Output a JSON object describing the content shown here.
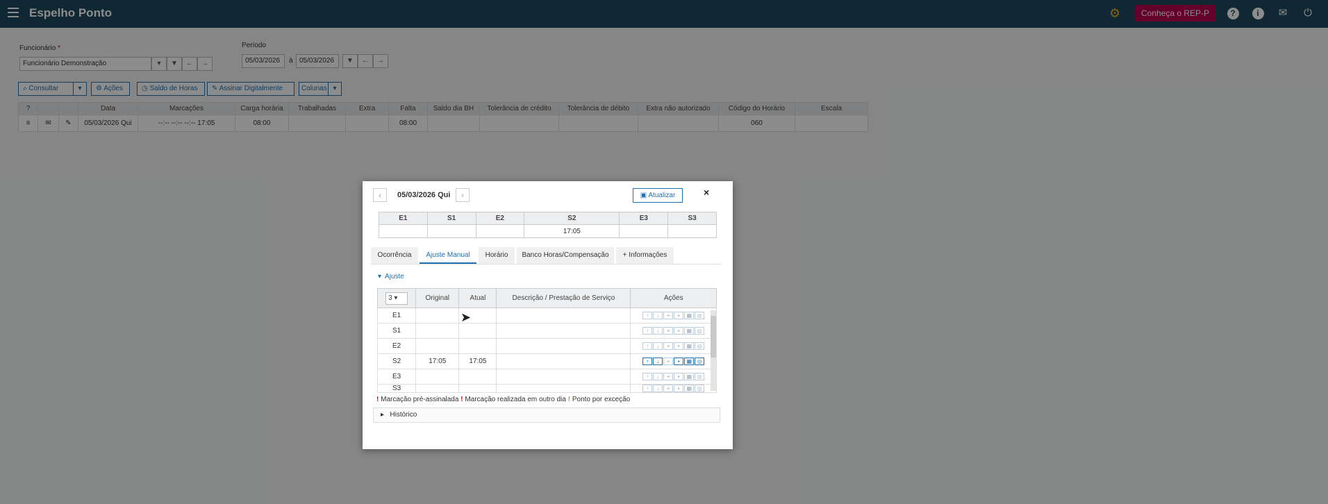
{
  "app": {
    "title": "Espelho Ponto",
    "rep_button": "Conheça o REP-P"
  },
  "filters": {
    "funcionario_label": "Funcionário",
    "required_mark": "*",
    "funcionario_value": "Funcionário Demonstração",
    "periodo_label": "Período",
    "date_from": "05/03/2026",
    "date_sep": "à",
    "date_to": "05/03/2026"
  },
  "toolbar": {
    "consultar": "Consultar",
    "acoes": "Ações",
    "saldo": "Saldo de Horas",
    "assinar": "Assinar Digitalmente",
    "colunas": "Colunas"
  },
  "grid": {
    "headers": [
      "?",
      "",
      "",
      "Data",
      "Marcações",
      "Carga horária",
      "Trabalhadas",
      "Extra",
      "Falta",
      "Saldo dia BH",
      "Tolerância de crédito",
      "Tolerância de débito",
      "Extra não autorizado",
      "Código do Horário",
      "Escala"
    ],
    "row": {
      "data": "05/03/2026 Qui",
      "marcacoes": "--:-- --:-- --:-- 17:05",
      "carga": "08:00",
      "trabalhadas": "",
      "extra": "",
      "falta": "08:00",
      "saldo": "",
      "tol_credito": "",
      "tol_debito": "",
      "extra_nao": "",
      "codigo": "060",
      "escala": ""
    }
  },
  "modal": {
    "date": "05/03/2026 Qui",
    "atualizar": "Atualizar",
    "close": "×",
    "marks_headers": [
      "E1",
      "S1",
      "E2",
      "S2",
      "E3",
      "S3"
    ],
    "marks_values": [
      "",
      "",
      "",
      "17:05",
      "",
      ""
    ],
    "tabs": [
      "Ocorrência",
      "Ajuste Manual",
      "Horário",
      "Banco Horas/Compensação",
      "+ Informações"
    ],
    "section": "Ajuste",
    "adj_select": "3",
    "adj_headers": [
      "Original",
      "Atual",
      "Descrição / Prestação de Serviço",
      "Ações"
    ],
    "adj_rows": [
      {
        "label": "E1",
        "original": "",
        "atual": ""
      },
      {
        "label": "S1",
        "original": "",
        "atual": ""
      },
      {
        "label": "E2",
        "original": "",
        "atual": ""
      },
      {
        "label": "S2",
        "original": "17:05",
        "atual": "17:05"
      },
      {
        "label": "E3",
        "original": "",
        "atual": ""
      },
      {
        "label": "S3",
        "original": "",
        "atual": ""
      }
    ],
    "legend": {
      "mark1": "!",
      "text1": "Marcação pré-assinalada",
      "mark2": "!",
      "text2": "Marcação realizada em outro dia",
      "mark3": "!",
      "text3": "Ponto por exceção"
    },
    "historico": "Histórico"
  },
  "icons": {
    "menu": "menu-icon",
    "gear": "gear-icon",
    "help": "help-icon",
    "info": "info-icon",
    "mail": "mail-icon",
    "power": "power-icon",
    "search": "search-icon",
    "filter": "filter-icon",
    "arrow_left": "arrow-left-icon",
    "arrow_right": "arrow-right-icon",
    "save": "save-icon",
    "edit": "edit-icon"
  },
  "colors": {
    "topbar": "#1e4a5e",
    "rep_button": "#b8004d",
    "accent": "#1e6fb0"
  }
}
